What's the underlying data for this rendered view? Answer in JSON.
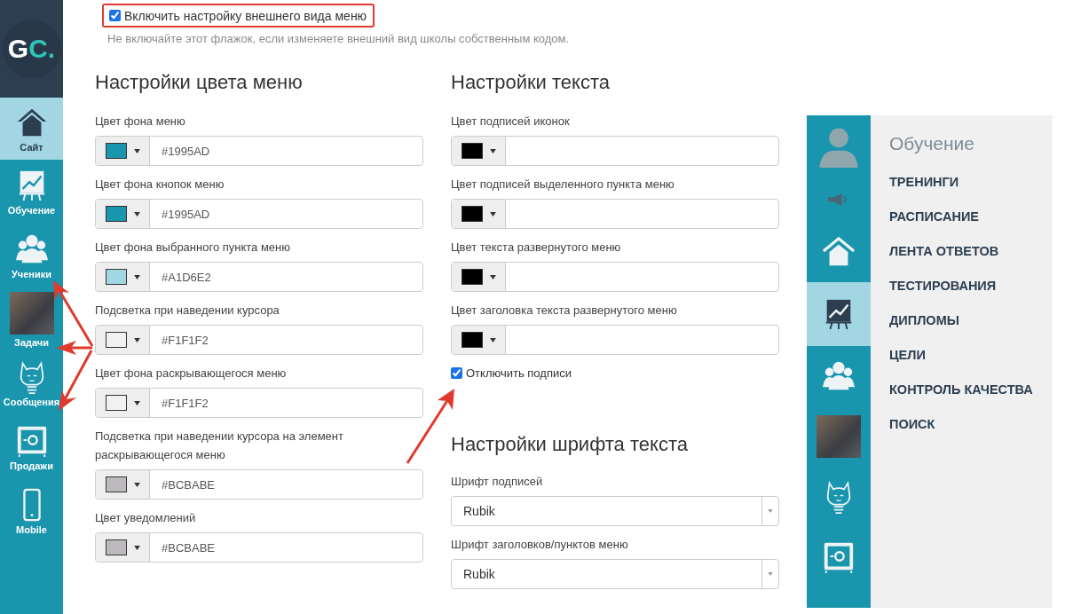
{
  "sidebar": {
    "logo": "GC.",
    "items": [
      {
        "label": "Сайт",
        "kind": "home",
        "selected": true
      },
      {
        "label": "Обучение",
        "kind": "chart",
        "selected": false
      },
      {
        "label": "Ученики",
        "kind": "people",
        "selected": false
      },
      {
        "label": "Задачи",
        "kind": "photo",
        "selected": false
      },
      {
        "label": "Сообщения",
        "kind": "bulb",
        "selected": false
      },
      {
        "label": "Продажи",
        "kind": "safe",
        "selected": false
      },
      {
        "label": "Mobile",
        "kind": "phone",
        "selected": false
      }
    ]
  },
  "enable_option": {
    "label": "Включить настройку внешнего вида меню",
    "checked": true,
    "hint": "Не включайте этот флажок, если изменяете внешний вид школы собственным кодом."
  },
  "menu_colors": {
    "title": "Настройки цвета меню",
    "fields": [
      {
        "label": "Цвет фона меню",
        "color": "#1995ad",
        "value": "#1995AD"
      },
      {
        "label": "Цвет фона кнопок меню",
        "color": "#1995ad",
        "value": "#1995AD"
      },
      {
        "label": "Цвет фона выбранного пункта меню",
        "color": "#a1d6e2",
        "value": "#A1D6E2"
      },
      {
        "label": "Подсветка при наведении курсора",
        "color": "#f1f1f2",
        "value": "#F1F1F2"
      },
      {
        "label": "Цвет фона раскрывающегося меню",
        "color": "#f1f1f2",
        "value": "#F1F1F2"
      },
      {
        "label": "Подсветка при наведении курсора на элемент раскрывающегося меню",
        "color": "#bcbabe",
        "value": "#BCBABE"
      },
      {
        "label": "Цвет уведомлений",
        "color": "#bcbabe",
        "value": "#BCBABE"
      }
    ]
  },
  "text_settings": {
    "title": "Настройки текста",
    "fields": [
      {
        "label": "Цвет подписей иконок",
        "color": "#000000"
      },
      {
        "label": "Цвет подписей выделенного пункта меню",
        "color": "#000000"
      },
      {
        "label": "Цвет текста развернутого меню",
        "color": "#000000"
      },
      {
        "label": "Цвет заголовка текста развернутого меню",
        "color": "#000000"
      }
    ],
    "disable_labels": {
      "label": "Отключить подписи",
      "checked": true
    }
  },
  "font_settings": {
    "title": "Настройки шрифта текста",
    "fields": [
      {
        "label": "Шрифт подписей",
        "value": "Rubik"
      },
      {
        "label": "Шрифт заголовков/пунктов меню",
        "value": "Rubik"
      }
    ]
  },
  "preview": {
    "icons": [
      {
        "kind": "avatar",
        "selected": false
      },
      {
        "kind": "speaker",
        "selected": false
      },
      {
        "kind": "home",
        "selected": false
      },
      {
        "kind": "chart",
        "selected": true
      },
      {
        "kind": "people",
        "selected": false
      },
      {
        "kind": "photo",
        "selected": false
      },
      {
        "kind": "bulb",
        "selected": false
      },
      {
        "kind": "safe",
        "selected": false
      }
    ],
    "menu_title": "Обучение",
    "menu_items": [
      "ТРЕНИНГИ",
      "РАСПИСАНИЕ",
      "ЛЕНТА ОТВЕТОВ",
      "ТЕСТИРОВАНИЯ",
      "ДИПЛОМЫ",
      "ЦЕЛИ",
      "КОНТРОЛЬ КАЧЕСТВА",
      "ПОИСК"
    ]
  }
}
